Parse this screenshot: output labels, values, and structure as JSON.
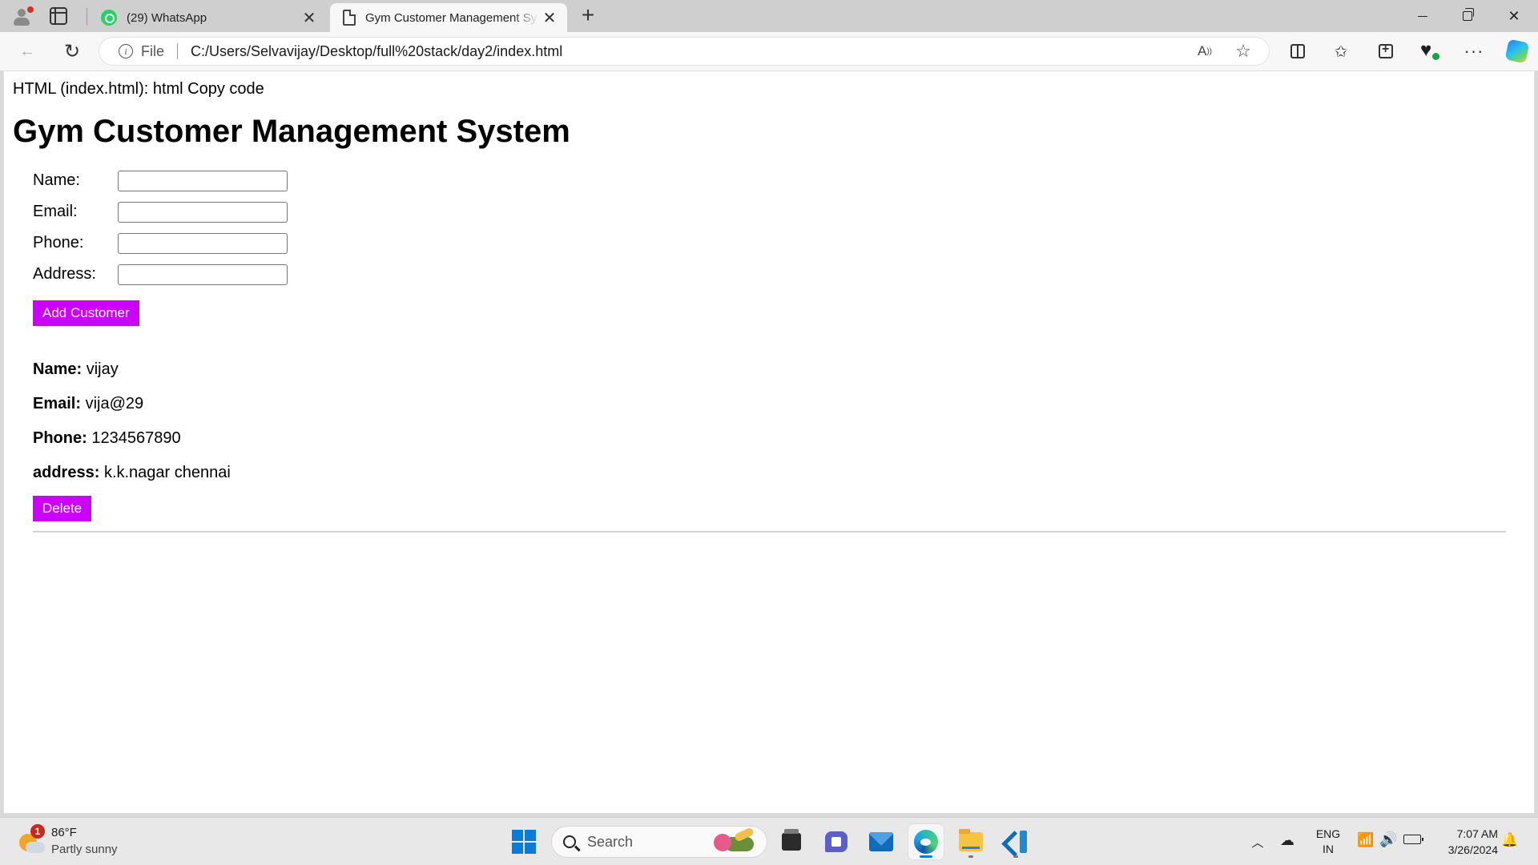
{
  "browser": {
    "tabs": [
      {
        "title": "(29) WhatsApp",
        "icon": "whatsapp-icon",
        "active": false
      },
      {
        "title": "Gym Customer Management System",
        "icon": "document-icon",
        "active": true
      }
    ],
    "address": {
      "scheme_label": "File",
      "url": "C:/Users/Selvavijay/Desktop/full%20stack/day2/index.html"
    },
    "colors": {
      "tab_strip": "#cfcfcf",
      "toolbar": "#f7f7f7"
    }
  },
  "page": {
    "intro_text": "HTML (index.html): html Copy code",
    "title": "Gym Customer Management System",
    "form": {
      "name_label": "Name:",
      "email_label": "Email:",
      "phone_label": "Phone:",
      "address_label": "Address:",
      "name_value": "",
      "email_value": "",
      "phone_value": "",
      "address_value": "",
      "submit_label": "Add Customer"
    },
    "customers": [
      {
        "name_label": "Name:",
        "name": "vijay",
        "email_label": "Email:",
        "email": "vija@29",
        "phone_label": "Phone:",
        "phone": "1234567890",
        "address_label": "address:",
        "address": "k.k.nagar chennai",
        "delete_label": "Delete"
      }
    ],
    "colors": {
      "button_bg": "#cc00ff",
      "button_text": "#ffffff"
    }
  },
  "taskbar": {
    "weather": {
      "badge": "1",
      "temp": "86°F",
      "condition": "Partly sunny"
    },
    "search_label": "Search",
    "apps": [
      "start-icon",
      "file-manager-icon",
      "teams-icon",
      "mail-icon",
      "edge-icon",
      "file-explorer-icon",
      "vscode-icon"
    ],
    "tray": {
      "lang_primary": "ENG",
      "lang_secondary": "IN",
      "time": "7:07 AM",
      "date": "3/26/2024"
    }
  }
}
